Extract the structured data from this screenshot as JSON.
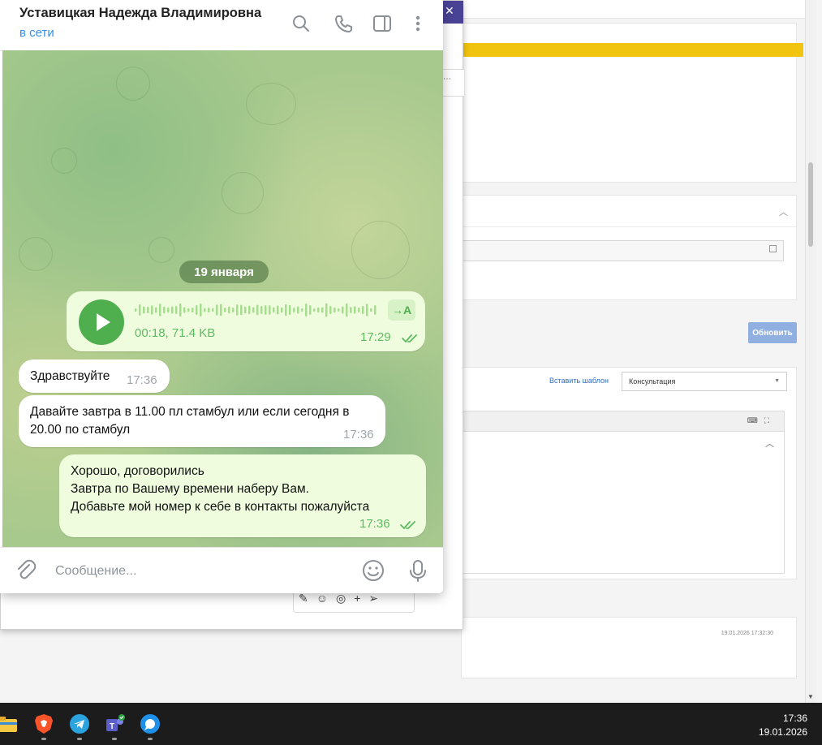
{
  "chat": {
    "contact_name": "Уставицкая Надежда Владимировна",
    "status": "в сети",
    "date_separator": "19 января",
    "voice_message": {
      "duration_size": "00:18, 71.4 KB",
      "time": "17:29",
      "transcribe_label": "→A",
      "progress": 0
    },
    "messages": [
      {
        "direction": "in",
        "text": "Здравствуйте",
        "time": "17:36"
      },
      {
        "direction": "in",
        "text": "Давайте завтра в 11.00 пл стамбул или если сегодня в 20.00 по стамбул",
        "time": "17:36"
      },
      {
        "direction": "out",
        "text": "Хорошо, договорились\nЗавтра по Вашему времени наберу Вам.\nДобавьте мой номер к себе в контакты пожалуйста",
        "time": "17:36"
      }
    ],
    "composer_placeholder": "Сообщение..."
  },
  "background_app": {
    "refresh_button": "Обновить",
    "insert_template_link": "Вставить шаблон",
    "template_select_value": "Консультация",
    "record_timestamp": "19.01.2026 17:32:30",
    "accent_yellow": "#f1c40f",
    "button_blue": "#8fb0e0"
  },
  "taskbar": {
    "icons": [
      "file-explorer-icon",
      "brave-browser-icon",
      "telegram-icon",
      "teams-icon",
      "skype-icon"
    ],
    "time": "17:36",
    "date": "19.01.2026"
  },
  "colors": {
    "telegram_blue": "#3390ec",
    "outgoing_bubble": "#effdde",
    "outgoing_accent": "#4fae4e"
  }
}
